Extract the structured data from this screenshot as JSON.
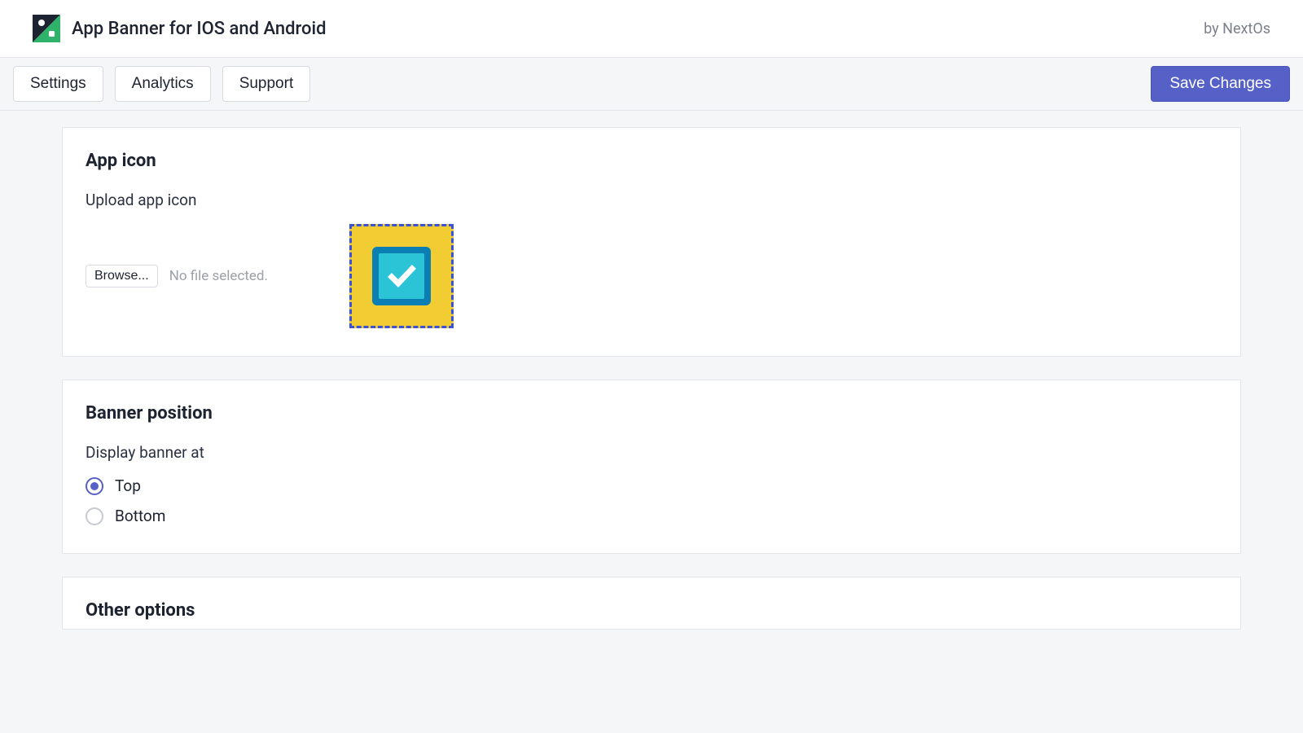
{
  "header": {
    "title": "App Banner for IOS and Android",
    "byline": "by NextOs"
  },
  "toolbar": {
    "settings_label": "Settings",
    "analytics_label": "Analytics",
    "support_label": "Support",
    "save_label": "Save Changes"
  },
  "app_icon_card": {
    "title": "App icon",
    "upload_label": "Upload app icon",
    "browse_label": "Browse...",
    "file_status": "No file selected."
  },
  "banner_position_card": {
    "title": "Banner position",
    "display_label": "Display banner at",
    "options": {
      "top": "Top",
      "bottom": "Bottom"
    },
    "selected": "Top"
  },
  "other_options_card": {
    "title": "Other options"
  }
}
